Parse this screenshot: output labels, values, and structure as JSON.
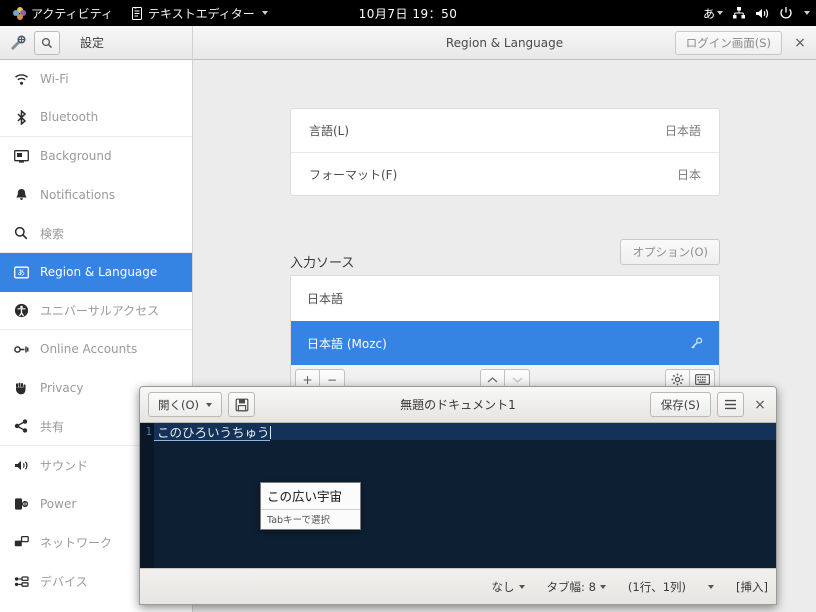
{
  "topbar": {
    "activities_label": "アクティビティ",
    "app_menu_label": "テキストエディター",
    "clock": "10月7日  19：50",
    "ime_label": "あ",
    "icons": [
      "network-icon",
      "volume-icon",
      "power-icon"
    ]
  },
  "settings": {
    "app_name": "設定",
    "title": "Region & Language",
    "login_screen_button": "ログイン画面(S)",
    "close_label": "×",
    "sidebar": [
      {
        "label": "Wi-Fi",
        "icon": "wifi-icon",
        "active": false
      },
      {
        "label": "Bluetooth",
        "icon": "bluetooth-icon",
        "active": false
      },
      {
        "label": "Background",
        "icon": "background-icon",
        "active": false
      },
      {
        "label": "Notifications",
        "icon": "bell-icon",
        "active": false
      },
      {
        "label": "検索",
        "icon": "search-icon",
        "active": false
      },
      {
        "label": "Region & Language",
        "icon": "region-icon",
        "active": true
      },
      {
        "label": "ユニバーサルアクセス",
        "icon": "accessibility-icon",
        "active": false
      },
      {
        "label": "Online Accounts",
        "icon": "online-accounts-icon",
        "active": false
      },
      {
        "label": "Privacy",
        "icon": "privacy-icon",
        "active": false
      },
      {
        "label": "共有",
        "icon": "sharing-icon",
        "active": false
      },
      {
        "label": "サウンド",
        "icon": "sound-icon",
        "active": false
      },
      {
        "label": "Power",
        "icon": "power-plug-icon",
        "active": false
      },
      {
        "label": "ネットワーク",
        "icon": "network-icon",
        "active": false
      },
      {
        "label": "デバイス",
        "icon": "devices-icon",
        "active": false
      }
    ],
    "rows": [
      {
        "label": "言語(L)",
        "value": "日本語"
      },
      {
        "label": "フォーマット(F)",
        "value": "日本"
      }
    ],
    "input_sources": {
      "section_title": "入力ソース",
      "options_button": "オプション(O)",
      "items": [
        {
          "label": "日本語",
          "selected": false
        },
        {
          "label": "日本語 (Mozc)",
          "selected": true
        }
      ],
      "toolbar": {
        "add": "+",
        "remove": "−",
        "move_up": "⌃",
        "move_down": "⌄",
        "preferences_icon": "gear-icon",
        "keyboard_icon": "keyboard-icon"
      }
    }
  },
  "gedit": {
    "open_button": "開く(O)",
    "save_icon_name": "save-icon",
    "title": "無題のドキュメント1",
    "save_button": "保存(S)",
    "menu_icon": "hamburger-menu-icon",
    "close_label": "×",
    "editor": {
      "line_number": "1",
      "preedit_text": "このひろいうちゅう"
    },
    "ime_popup": {
      "candidate": "この広い宇宙",
      "hint": "Tabキーで選択"
    },
    "statusbar": {
      "highlight_mode": "なし",
      "tab_width": "タブ幅: 8",
      "position": "(1行、1列)",
      "insert_mode": "[挿入]"
    }
  },
  "colors": {
    "accent_blue": "#3584e4",
    "topbar_bg": "#000000",
    "editor_bg": "#0d1f33",
    "editor_line_highlight": "#143257"
  }
}
